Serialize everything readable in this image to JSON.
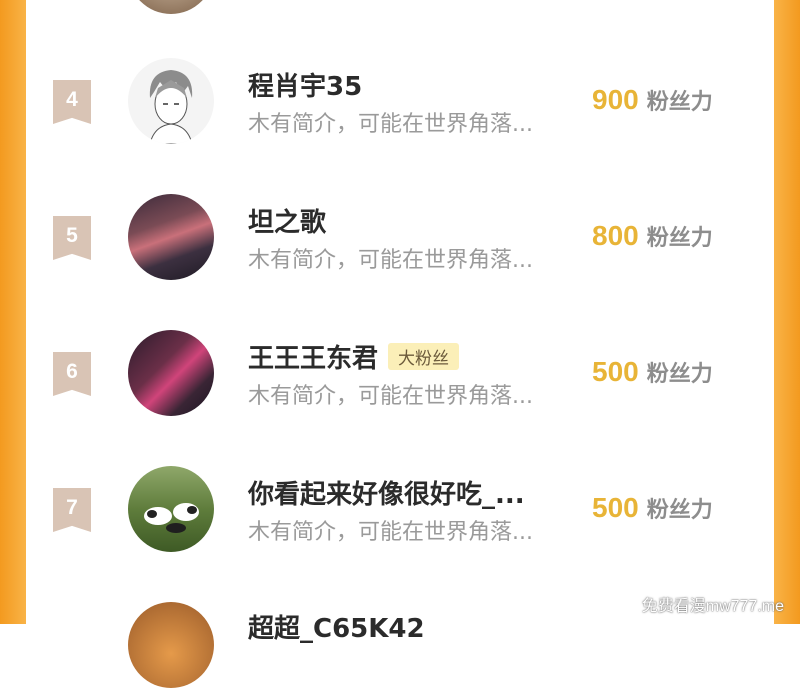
{
  "rows": [
    {
      "rank": "4",
      "name": "程肖宇35",
      "bio": "木有简介，可能在世界角落...",
      "fans": "900",
      "fans_unit": "粉丝力",
      "badge": ""
    },
    {
      "rank": "5",
      "name": "坦之歌",
      "bio": "木有简介，可能在世界角落...",
      "fans": "800",
      "fans_unit": "粉丝力",
      "badge": ""
    },
    {
      "rank": "6",
      "name": "王王王东君",
      "bio": "木有简介，可能在世界角落...",
      "fans": "500",
      "fans_unit": "粉丝力",
      "badge": "大粉丝"
    },
    {
      "rank": "7",
      "name": "你看起来好像很好吃_...",
      "bio": "木有简介，可能在世界角落...",
      "fans": "500",
      "fans_unit": "粉丝力",
      "badge": ""
    }
  ],
  "partial_next_name": "超超_C65K42",
  "watermark": "免费看漫mw777.me",
  "colors": {
    "frame": "#f8a22a",
    "fans_number": "#e8b437",
    "rank_ribbon": "#d9c4b5",
    "badge_bg": "#fbefb8"
  }
}
